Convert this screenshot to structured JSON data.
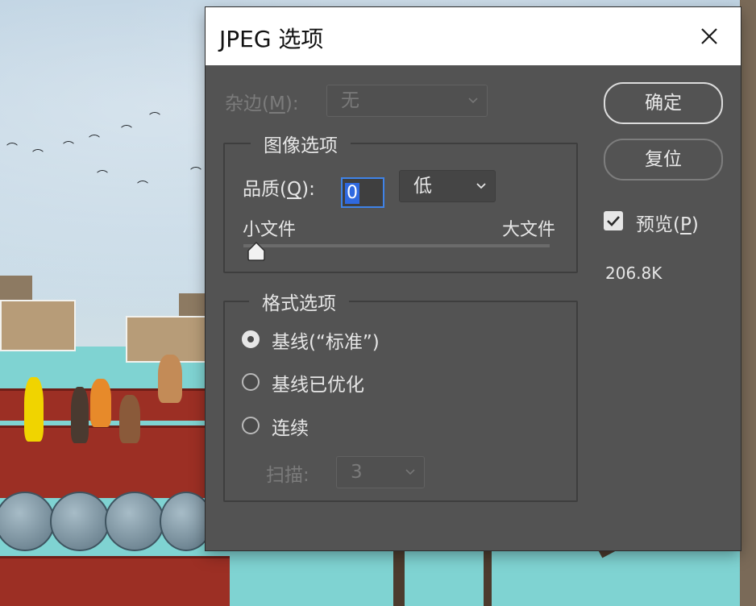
{
  "dialog": {
    "title": "JPEG 选项",
    "matte": {
      "label_prefix": "杂边(",
      "label_key": "M",
      "label_suffix": "):",
      "value": "无"
    },
    "image_options": {
      "legend": "图像选项",
      "quality_label_prefix": "品质(",
      "quality_label_key": "Q",
      "quality_label_suffix": "):",
      "quality_value": "0",
      "quality_preset": "低",
      "slider_min_label": "小文件",
      "slider_max_label": "大文件",
      "slider_value": 0
    },
    "format_options": {
      "legend": "格式选项",
      "radios": [
        {
          "label": "基线(“标准”)",
          "selected": true
        },
        {
          "label": "基线已优化",
          "selected": false
        },
        {
          "label": "连续",
          "selected": false
        }
      ],
      "scans_label": "扫描:",
      "scans_value": "3"
    },
    "buttons": {
      "ok": "确定",
      "reset": "复位"
    },
    "preview": {
      "label_prefix": "预览(",
      "label_key": "P",
      "label_suffix": ")",
      "checked": true
    },
    "file_size": "206.8K"
  },
  "colors": {
    "dialog_bg": "#535353",
    "focus_accent": "#3f83e8",
    "titlebar_bg": "#ffffff"
  },
  "icons": [
    "close-icon",
    "chevron-down-icon",
    "checkmark-icon",
    "slider-thumb-icon"
  ]
}
